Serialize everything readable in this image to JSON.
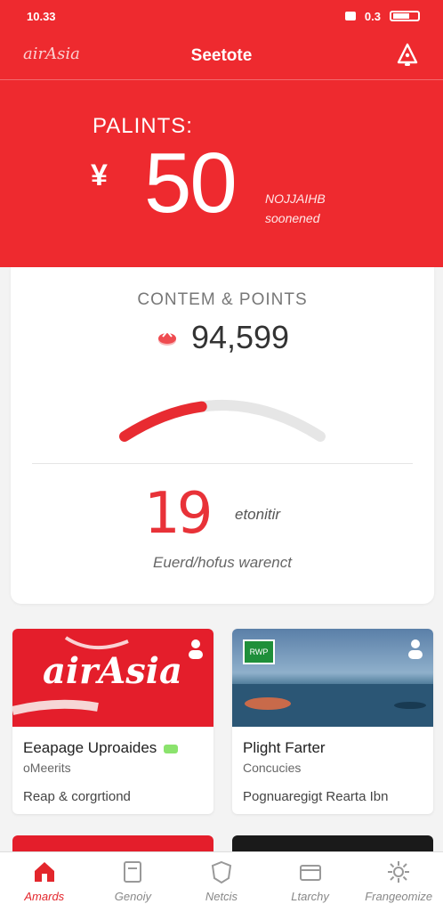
{
  "status_bar": {
    "time": "10.33",
    "right_text": "0.3"
  },
  "header": {
    "logo": "airAsia",
    "title": "Seetote"
  },
  "points": {
    "label": "PALINTS:",
    "currency": "¥",
    "value": "50",
    "note_line1": "NOJJAIHB",
    "note_line2": "soonened"
  },
  "summary": {
    "section_label": "CONTEM & POINTS",
    "balance": "94,599",
    "progress_fraction": 0.5,
    "count": "19",
    "count_label": "etonitir",
    "caption": "Euerd/hofus warenct"
  },
  "offers": [
    {
      "image_text": "airAsia",
      "title": "Eeapage Uproaides",
      "subtitle": "oMeerits",
      "description": "Reap & corgrtiond"
    },
    {
      "image_text": "RWP",
      "title": "Plight Farter",
      "subtitle": "Concucies",
      "description": "Pognuaregigt Rearta Ibn"
    }
  ],
  "nav": [
    {
      "label": "Amards",
      "icon": "home-icon",
      "active": true
    },
    {
      "label": "Genoiy",
      "icon": "card-icon",
      "active": false
    },
    {
      "label": "Netcis",
      "icon": "shield-icon",
      "active": false
    },
    {
      "label": "Ltarchy",
      "icon": "wallet-icon",
      "active": false
    },
    {
      "label": "Frangeomize",
      "icon": "settings-icon",
      "active": false
    }
  ],
  "colors": {
    "brand_red": "#ee2a2f",
    "accent_red": "#e3262c",
    "background": "#f3f3f3"
  }
}
